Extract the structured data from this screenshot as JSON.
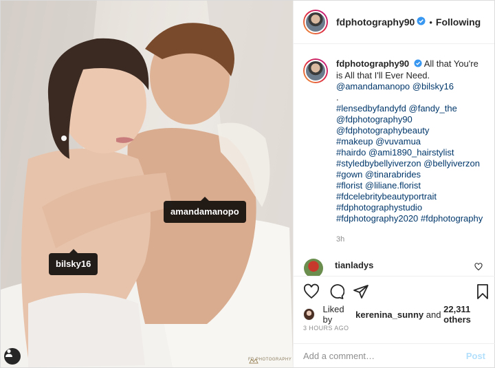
{
  "post": {
    "username": "fdphotography90",
    "follow_state": "Following",
    "dot": "•"
  },
  "photo": {
    "tags": [
      "amandamanopo",
      "bilsky16"
    ],
    "watermark": "FD PHOTOGRAPHY",
    "icons": {
      "user_tags": "user-tags-icon"
    }
  },
  "caption": {
    "username": "fdphotography90",
    "first_line": "All that You're is All that I'll Ever Need.",
    "lines": [
      {
        "text": "@amandamanopo @bilsky16",
        "kind": "link"
      },
      {
        "text": ".",
        "kind": "plain"
      },
      {
        "text": "#lensedbyfandyfd @fandy_the",
        "kind": "link"
      },
      {
        "text": "@fdphotography90",
        "kind": "link"
      },
      {
        "text": "@fdphotographybeauty",
        "kind": "link"
      },
      {
        "text": "#makeup @vuvamua",
        "kind": "link"
      },
      {
        "text": "#hairdo @ami1890_hairstylist",
        "kind": "link"
      },
      {
        "text": "#styledbybellyiverzon @bellyiverzon",
        "kind": "link"
      },
      {
        "text": "#gown @tinarabrides",
        "kind": "link"
      },
      {
        "text": "#florist @liliane.florist",
        "kind": "link"
      },
      {
        "text": "#fdcelebritybeautyportrait",
        "kind": "link"
      },
      {
        "text": "#fdphotographystudio",
        "kind": "link"
      },
      {
        "text": "#fdphotography2020 #fdphotography",
        "kind": "link"
      }
    ],
    "age": "3h"
  },
  "comment": {
    "username": "tianladys"
  },
  "likes": {
    "prefix": "Liked by",
    "user": "kerenina_sunny",
    "middle": "and",
    "count": "22,311 others"
  },
  "post_time": "3 HOURS AGO",
  "comment_box": {
    "placeholder": "Add a comment…",
    "post_label": "Post"
  },
  "colors": {
    "link": "#00376b",
    "verified": "#3897f0",
    "post_button_disabled": "#b2dffc"
  },
  "icons": [
    "verified-icon",
    "heart-icon",
    "comment-icon",
    "share-icon",
    "bookmark-icon"
  ]
}
